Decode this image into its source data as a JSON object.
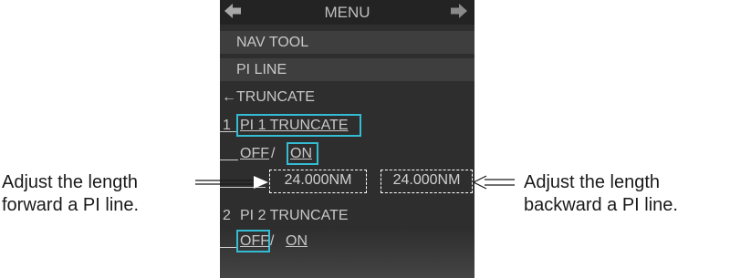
{
  "menu": {
    "title": "MENU",
    "back_icon": "left-arrow-icon",
    "forward_icon": "right-arrow-icon",
    "items": {
      "nav_tool": "NAV TOOL",
      "pi_line": "PI LINE",
      "back_arrow": "←",
      "truncate": "TRUNCATE",
      "pi1_number": "1",
      "pi1_truncate": "PI 1 TRUNCATE",
      "pi1_off": "OFF",
      "pi1_sep": " / ",
      "pi1_on": "ON",
      "forward_length": "24.000NM",
      "backward_length": "24.000NM",
      "pi2_number": "2",
      "pi2_truncate": "PI 2 TRUNCATE",
      "pi2_off": "OFF",
      "pi2_sep": " / ",
      "pi2_on": "ON"
    }
  },
  "callouts": {
    "left_line1": "Adjust the length",
    "left_line2": "forward a PI line.",
    "right_line1": "Adjust the length",
    "right_line2": "backward a PI line."
  },
  "colors": {
    "highlight": "#33bcd4",
    "panel": "#2e2e2e",
    "text": "#c8c8c8"
  }
}
